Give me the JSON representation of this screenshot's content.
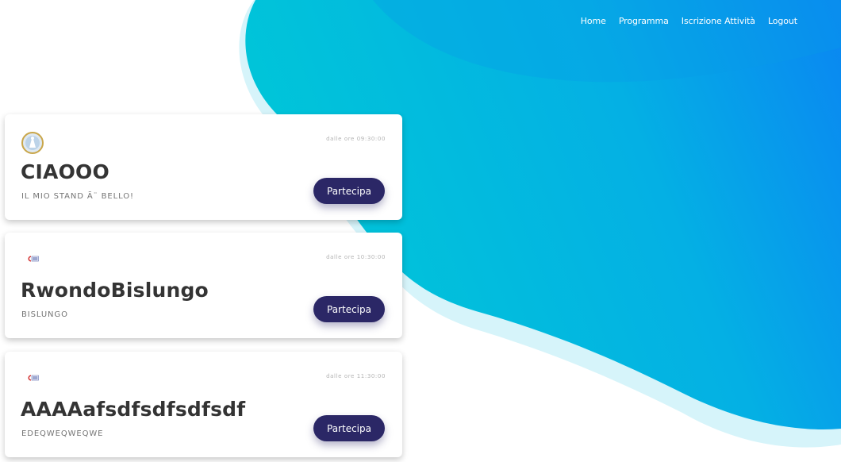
{
  "nav": {
    "items": [
      "Home",
      "Programma",
      "Iscrizione Attività",
      "Logout"
    ]
  },
  "colors": {
    "gradient_start": "#00c4d8",
    "gradient_end": "#0a8af0",
    "blob_outline": "#d6f4fa",
    "button": "#2b2766"
  },
  "cards": [
    {
      "logo_icon": "globe-emblem-icon",
      "time": "dalle ore 09:30:00",
      "title": "CIAOOO",
      "subtitle": "IL MIO STAND Ã¨ BELLO!",
      "button_label": "Partecipa"
    },
    {
      "logo_icon": "red-c-logo-icon",
      "time": "dalle ore 10:30:00",
      "title": "RwondoBislungo",
      "subtitle": "BISLUNGO",
      "button_label": "Partecipa"
    },
    {
      "logo_icon": "red-c-logo-icon",
      "time": "dalle ore 11:30:00",
      "title": "AAAAafsdfsdfsdfsdf",
      "subtitle": "EDEQWEQWEQWE",
      "button_label": "Partecipa"
    }
  ]
}
